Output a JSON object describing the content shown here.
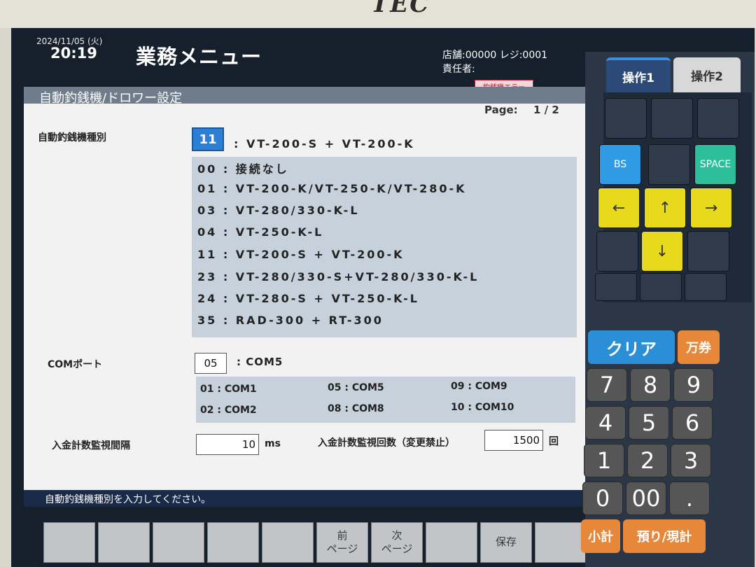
{
  "brand": "TEC",
  "header": {
    "date": "2024/11/05 (火)",
    "time": "20:19",
    "menu_title": "業務メニュー",
    "store_line": "店舗:00000  レジ:0001",
    "manager_line": "責任者:",
    "error_badge": "釣銭機エラー"
  },
  "section": {
    "title": "自動釣銭機/ドロワー設定"
  },
  "page": {
    "label": "Page:",
    "value": "1 / 2"
  },
  "machine_type": {
    "label": "自動釣銭機種別",
    "input": "11",
    "value": ": VT-200-S + VT-200-K",
    "options": [
      "00 : 接続なし",
      "01 : VT-200-K/VT-250-K/VT-280-K",
      "03 : VT-280/330-K-L",
      "04 : VT-250-K-L",
      "11 : VT-200-S + VT-200-K",
      "23 : VT-280/330-S+VT-280/330-K-L",
      "24 : VT-280-S + VT-250-K-L",
      "35 : RAD-300 + RT-300"
    ]
  },
  "com_port": {
    "label": "COMポート",
    "input": "05",
    "value": ": COM5",
    "options": [
      "01 : COM1",
      "05 : COM5",
      "09 : COM9",
      "02 : COM2",
      "08 : COM8",
      "10 : COM10"
    ]
  },
  "interval": {
    "label": "入金計数監視間隔",
    "value": "10",
    "unit": "ms"
  },
  "count": {
    "label": "入金計数監視回数（変更禁止）",
    "value": "1500",
    "unit": "回"
  },
  "status_message": "自動釣銭機種別を入力してください。",
  "function_keys": {
    "prev_line1": "前",
    "prev_line2": "ページ",
    "next_line1": "次",
    "next_line2": "ページ",
    "save": "保存"
  },
  "tabs": [
    "操作1",
    "操作2"
  ],
  "keypad": {
    "bs": "BS",
    "space": "SPACE",
    "left": "←",
    "up": "↑",
    "right": "→",
    "down": "↓"
  },
  "numpad": {
    "clear": "クリア",
    "voucher": "万券",
    "digits": [
      "7",
      "8",
      "9",
      "4",
      "5",
      "6",
      "1",
      "2",
      "3",
      "0",
      "00",
      "."
    ],
    "subtotal": "小計",
    "deposit": "預り/現計"
  }
}
